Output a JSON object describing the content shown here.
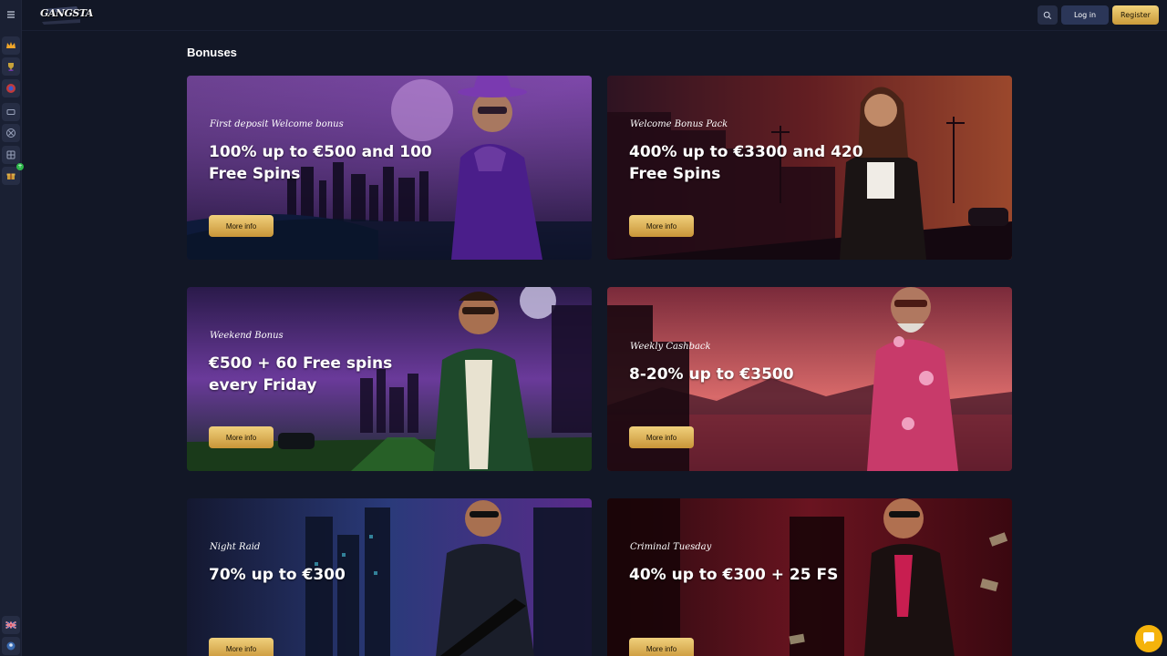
{
  "header": {
    "logo_text": "GANGSTA",
    "login_label": "Log in",
    "register_label": "Register"
  },
  "sidebar": {
    "items": [
      {
        "icon": "menu-icon"
      },
      {
        "icon": "crown-icon"
      },
      {
        "icon": "trophy-icon"
      },
      {
        "icon": "wheel-icon"
      },
      {
        "icon": "ticket-icon"
      },
      {
        "icon": "chip-icon"
      },
      {
        "icon": "grid-icon"
      },
      {
        "icon": "gift-icon",
        "badge": "+"
      },
      {
        "icon": "uk-flag-icon"
      },
      {
        "icon": "support-icon"
      }
    ]
  },
  "page": {
    "title": "Bonuses"
  },
  "bonuses": [
    {
      "subtitle": "First deposit Welcome bonus",
      "title": "100% up to €500 and 100 Free Spins",
      "button": "More info",
      "accent": "#6d2fa3"
    },
    {
      "subtitle": "Welcome Bonus Pack",
      "title": "400% up to €3300 and 420 Free Spins",
      "button": "More info",
      "accent": "#c4442a"
    },
    {
      "subtitle": "Weekend Bonus",
      "title": "€500 + 60 Free spins every Friday",
      "button": "More info",
      "accent": "#5a2a8a"
    },
    {
      "subtitle": "Weekly Cashback",
      "title": "8-20% up to €3500",
      "button": "More info",
      "accent": "#b83a4a"
    },
    {
      "subtitle": "Night Raid",
      "title": "70% up to €300",
      "button": "More info",
      "accent": "#2a3a8a"
    },
    {
      "subtitle": "Criminal Tuesday",
      "title": "40% up to €300 + 25 FS",
      "button": "More info",
      "accent": "#8a1a22"
    }
  ],
  "colors": {
    "background": "#121726",
    "sidebar": "#1a2033",
    "gold": "#e8c164",
    "login_bg": "#2b3658",
    "chat": "#f5b30b"
  }
}
